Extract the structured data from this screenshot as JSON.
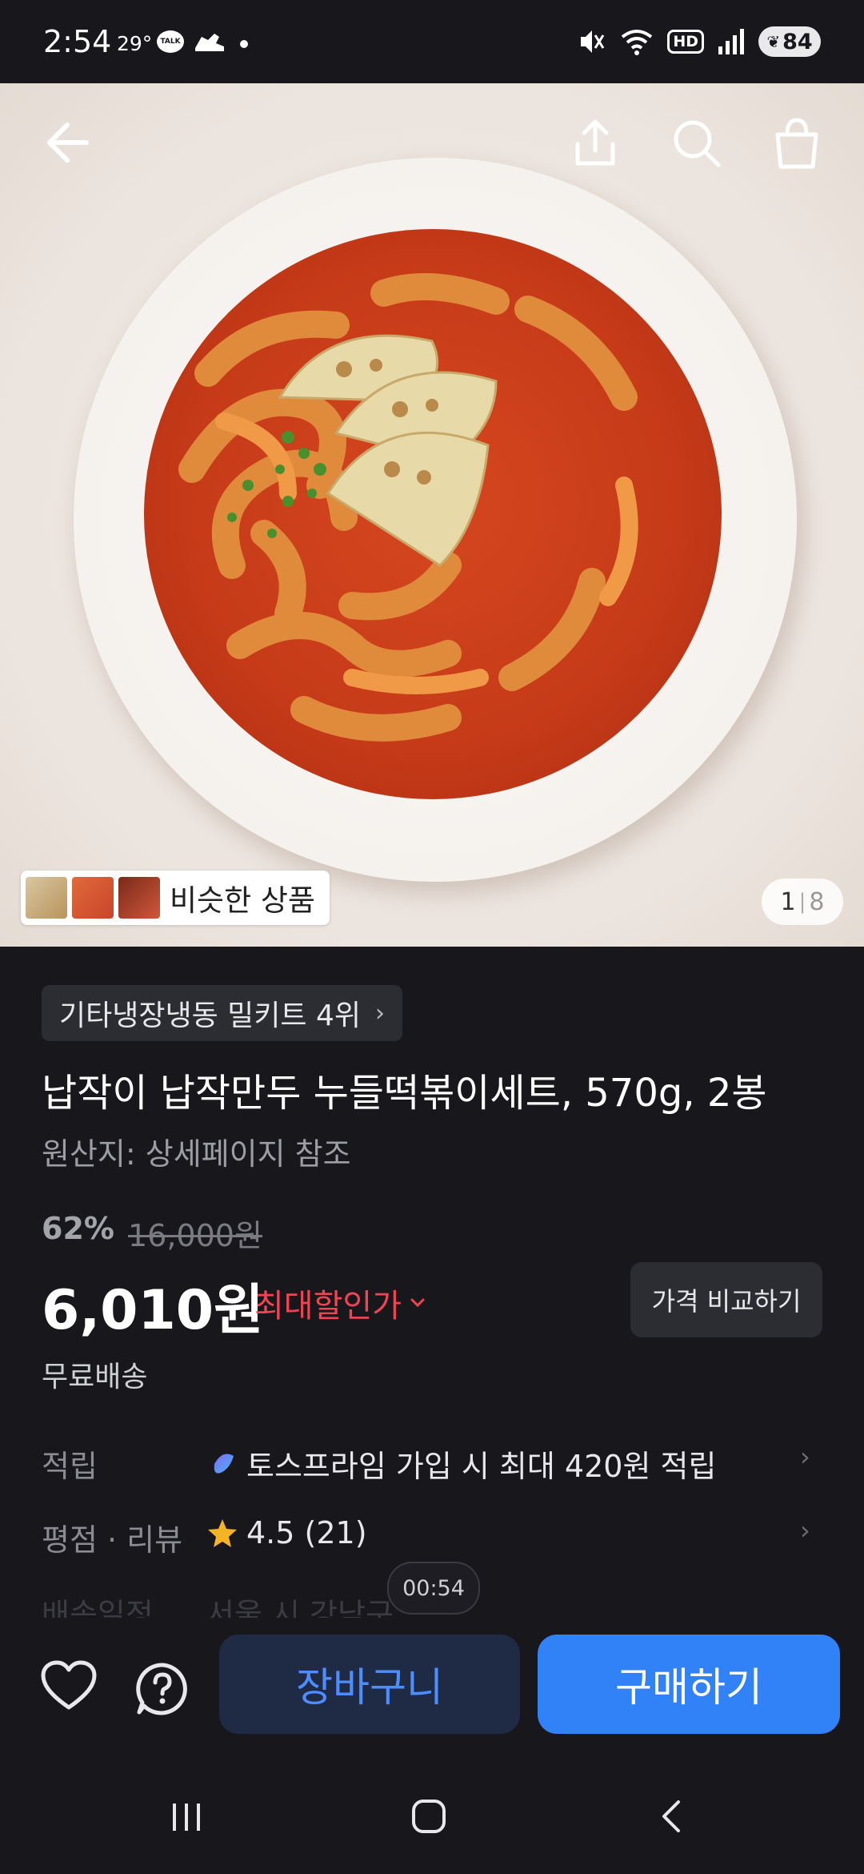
{
  "status_bar": {
    "time": "2:54",
    "temperature": "29°",
    "kakao_badge": "TALK",
    "hd_label": "HD",
    "battery": "84"
  },
  "hero": {
    "similar_products_label": "비슷한 상품",
    "page_current": "1",
    "page_total": "8"
  },
  "product": {
    "rank_badge": "기타냉장냉동 밀키트 4위",
    "title": "납작이 납작만두 누들떡볶이세트, 570g, 2봉",
    "origin": "원산지: 상세페이지 참조",
    "discount_rate": "62%",
    "original_price": "16,000원",
    "price": "6,010원",
    "max_discount_label": "최대할인가",
    "compare_button": "가격 비교하기",
    "shipping": "무료배송"
  },
  "rows": {
    "points_label": "적립",
    "points_value": "토스프라임 가입 시 최대 420원 적립",
    "rating_label": "평점 · 리뷰",
    "rating_value": "4.5 (21)",
    "delivery_label": "배송일정",
    "delivery_value": "서울 시 강남구"
  },
  "timer": "00:54",
  "actions": {
    "cart_button": "장바구니",
    "buy_button": "구매하기"
  },
  "colors": {
    "background": "#17171c",
    "accent_blue": "#3182f6",
    "discount_red": "#f04452",
    "star": "#f5b326"
  }
}
